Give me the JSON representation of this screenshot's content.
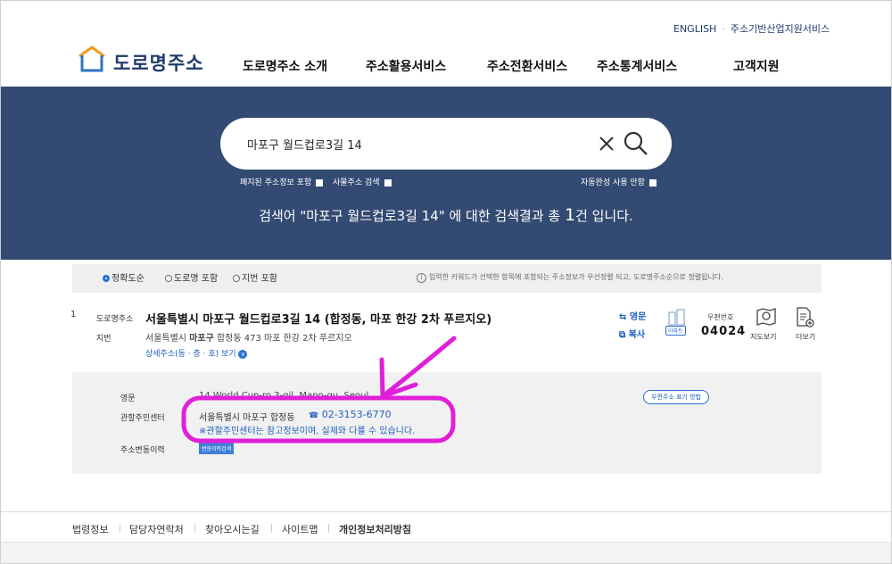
{
  "header": {
    "util_links": [
      "ENGLISH",
      "주소기반산업지원서비스"
    ],
    "logo_text": "도로명주소",
    "nav": [
      "도로명주소 소개",
      "주소활용서비스",
      "주소전환서비스",
      "주소통계서비스",
      "고객지원"
    ]
  },
  "search": {
    "query": "마포구 월드컵로3길 14",
    "options": {
      "abolished": "폐지된 주소정보 포함",
      "building": "사물주소 검색",
      "autocomplete": "자동완성 사용 안함"
    },
    "result_prefix": "검색어 \"마포구 월드컵로3길 14\" 에 대한 검색결과 총 ",
    "result_count": "1",
    "result_suffix": "건 입니다."
  },
  "filter": {
    "options": [
      "정확도순",
      "도로명 포함",
      "지번 포함"
    ],
    "selected": "정확도순",
    "note": "입력한 키워드가 선택한 항목에 포함되는 주소정보가 우선정렬 되고, 도로명주소순으로 정렬됩니다."
  },
  "result": {
    "index": "1",
    "road_label": "도로명주소",
    "road_address": "서울특별시 마포구 월드컵로3길 14 (합정동, 마포 한강 2차 푸르지오)",
    "jibun_label": "지번",
    "jibun_prefix": "서울특별시 ",
    "jibun_bold": "마포구",
    "jibun_suffix": " 합정동 473 마포 한강 2차 푸르지오",
    "detail_link": "상세주소(동 · 층 · 호) 보기",
    "english_btn": "영문",
    "copy_btn": "복사",
    "apt_badge": "아파트",
    "postal_label": "우편번호",
    "postal_code": "04024",
    "map_btn": "지도보기",
    "more_btn": "더보기"
  },
  "detail": {
    "english_label": "영문",
    "english_value": "14 World Cup-ro 3-gil, Mapo-gu, Seoul",
    "english_pill": "우편주소 표기 방법",
    "center_label": "관할주민센터",
    "center_name": "서울특별시 마포구 합정동",
    "center_phone": "02-3153-6770",
    "center_note": "※관할주민센터는 참고정보이며, 실제와 다를 수 있습니다.",
    "history_label": "주소변동이력",
    "history_tag": "변동이력검색"
  },
  "footer": {
    "links": [
      "법령정보",
      "담당자연락처",
      "찾아오시는길",
      "사이트맵",
      "개인정보처리방침"
    ]
  },
  "colors": {
    "banner": "#334a72",
    "highlight": "#e020d8",
    "link": "#1f5fbf"
  }
}
